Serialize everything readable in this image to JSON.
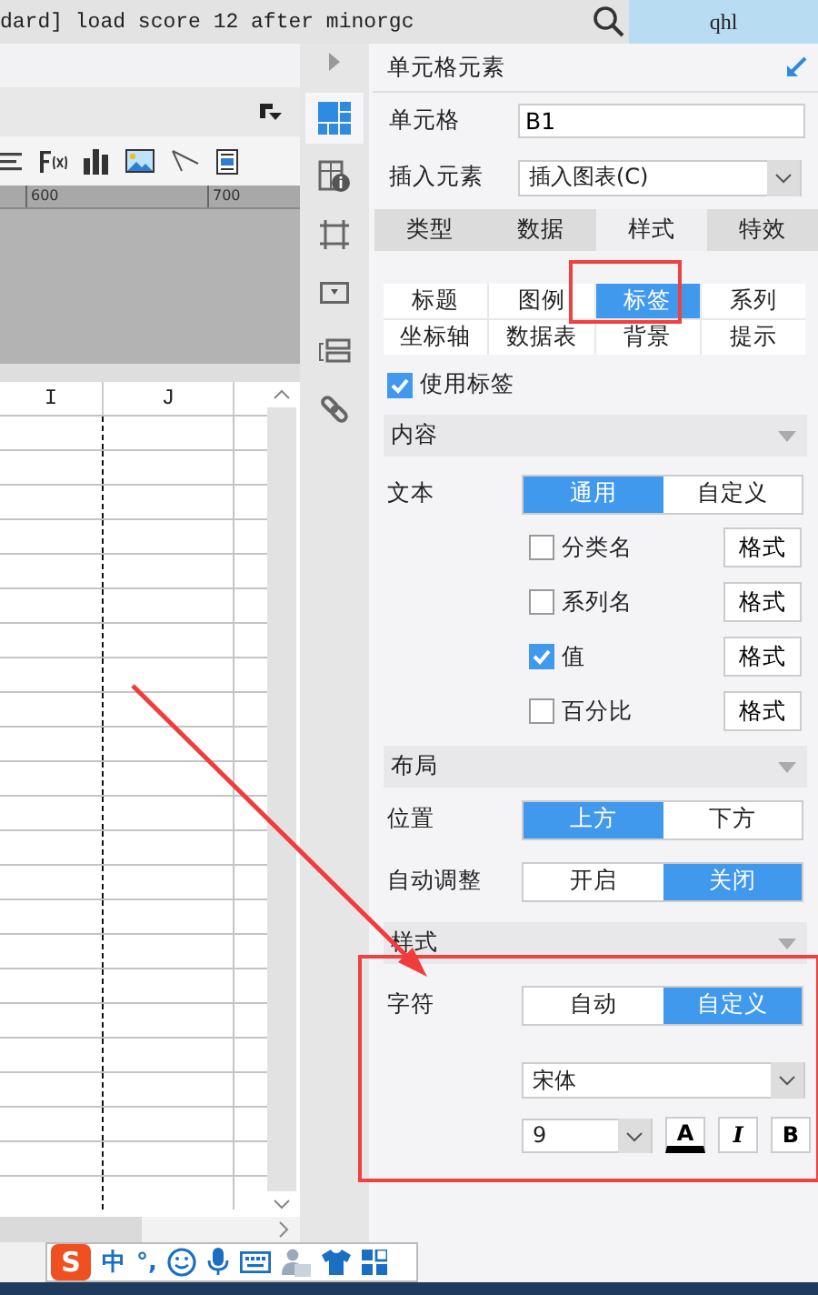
{
  "title_bar": {
    "log_text": "dard] load score 12 after minorgc",
    "user": "qhl"
  },
  "ruler": {
    "ticks": [
      "600",
      "700"
    ]
  },
  "sheet": {
    "columns": [
      "I",
      "J"
    ]
  },
  "side_tools": [
    {
      "kind": "grid",
      "selected": true
    },
    {
      "kind": "info",
      "selected": false
    },
    {
      "kind": "frame",
      "selected": false
    },
    {
      "kind": "dropdown",
      "selected": false
    },
    {
      "kind": "stack",
      "selected": false
    },
    {
      "kind": "link",
      "selected": false
    }
  ],
  "panel": {
    "title": "单元格元素",
    "fields": [
      {
        "kind": "input",
        "label": "单元格",
        "value": "B1"
      },
      {
        "kind": "select",
        "label": "插入元素",
        "value": "插入图表(C)"
      }
    ],
    "tabs": [
      {
        "label": "类型",
        "selected": false
      },
      {
        "label": "数据",
        "selected": false
      },
      {
        "label": "样式",
        "selected": true
      },
      {
        "label": "特效",
        "selected": false
      }
    ],
    "subtabs": [
      {
        "label": "标题",
        "selected": false
      },
      {
        "label": "图例",
        "selected": false
      },
      {
        "label": "标签",
        "selected": true
      },
      {
        "label": "系列",
        "selected": false
      },
      {
        "label": "坐标轴",
        "selected": false
      },
      {
        "label": "数据表",
        "selected": false
      },
      {
        "label": "背景",
        "selected": false
      },
      {
        "label": "提示",
        "selected": false
      }
    ],
    "use_labels": {
      "label": "使用标签",
      "checked": true
    },
    "content": {
      "title": "内容",
      "text_label": "文本",
      "modes": [
        {
          "label": "通用",
          "selected": true
        },
        {
          "label": "自定义",
          "selected": false
        }
      ],
      "options": [
        {
          "label": "分类名",
          "checked": false,
          "button": "格式"
        },
        {
          "label": "系列名",
          "checked": false,
          "button": "格式"
        },
        {
          "label": "值",
          "checked": true,
          "button": "格式"
        },
        {
          "label": "百分比",
          "checked": false,
          "button": "格式"
        }
      ]
    },
    "layout": {
      "title": "布局",
      "rows": [
        {
          "label": "位置",
          "choices": [
            {
              "label": "上方",
              "selected": true
            },
            {
              "label": "下方",
              "selected": false
            }
          ]
        },
        {
          "label": "自动调整",
          "choices": [
            {
              "label": "开启",
              "selected": false
            },
            {
              "label": "关闭",
              "selected": true
            }
          ]
        }
      ]
    },
    "style": {
      "title": "样式",
      "char_label": "字符",
      "choices": [
        {
          "label": "自动",
          "selected": false
        },
        {
          "label": "自定义",
          "selected": true
        }
      ],
      "font": "宋体",
      "size": "9",
      "buttons": [
        {
          "kind": "color",
          "label": "A"
        },
        {
          "kind": "italic",
          "label": "I"
        },
        {
          "kind": "bold",
          "label": "B"
        }
      ]
    }
  },
  "ime_bar": [
    {
      "kind": "logo",
      "label": "S"
    },
    {
      "kind": "text",
      "label": "中"
    },
    {
      "kind": "text",
      "label": "°,"
    },
    {
      "kind": "smiley"
    },
    {
      "kind": "mic"
    },
    {
      "kind": "keyboard"
    },
    {
      "kind": "person"
    },
    {
      "kind": "shirt"
    },
    {
      "kind": "grid"
    }
  ]
}
